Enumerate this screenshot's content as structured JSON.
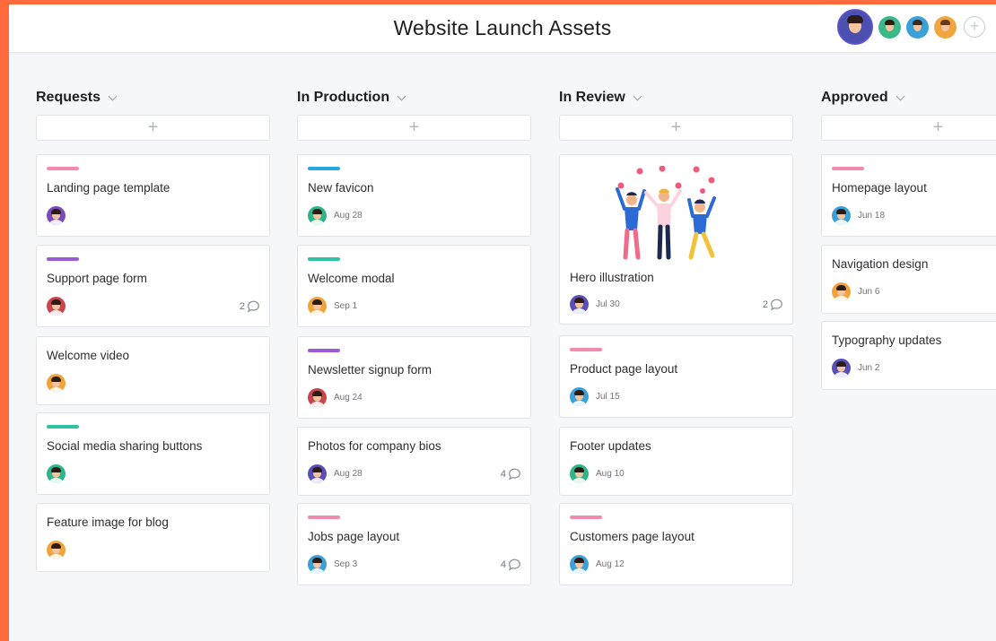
{
  "header": {
    "title": "Website Launch Assets",
    "members": [
      {
        "bg": "#4a4fb0"
      },
      {
        "bg": "#39b98a"
      },
      {
        "bg": "#3aa0d8"
      },
      {
        "bg": "#f0a640"
      }
    ],
    "add_label": "+"
  },
  "add_card_label": "+",
  "columns": [
    {
      "name": "Requests",
      "cards": [
        {
          "title": "Landing page template",
          "tag": "#f38aaf",
          "avatar": "#7a4ab8",
          "date": "",
          "comments": ""
        },
        {
          "title": "Support page form",
          "tag": "#9b5bd6",
          "avatar": "#c9454d",
          "date": "",
          "comments": "2"
        },
        {
          "title": "Welcome video",
          "tag": "",
          "avatar": "#f2a33a",
          "date": "",
          "comments": ""
        },
        {
          "title": "Social media sharing buttons",
          "tag": "#2ec4a2",
          "avatar": "#2eb58a",
          "date": "",
          "comments": ""
        },
        {
          "title": "Feature image for blog",
          "tag": "",
          "avatar": "#f2a33a",
          "date": "",
          "comments": ""
        }
      ]
    },
    {
      "name": "In Production",
      "cards": [
        {
          "title": "New favicon",
          "tag": "#29a8e0",
          "avatar": "#2eb58a",
          "date": "Aug 28",
          "comments": ""
        },
        {
          "title": "Welcome modal",
          "tag": "#2ec4a2",
          "avatar": "#f2a33a",
          "date": "Sep 1",
          "comments": ""
        },
        {
          "title": "Newsletter signup form",
          "tag": "#9b5bd6",
          "avatar": "#c9454d",
          "date": "Aug 24",
          "comments": ""
        },
        {
          "title": "Photos for company bios",
          "tag": "",
          "avatar": "#5a4fb8",
          "date": "Aug 28",
          "comments": "4"
        },
        {
          "title": "Jobs page layout",
          "tag": "#f38aaf",
          "avatar": "#3aa0d8",
          "date": "Sep 3",
          "comments": "4"
        }
      ]
    },
    {
      "name": "In Review",
      "cards": [
        {
          "title": "Hero illustration",
          "tag": "",
          "avatar": "#5a4fb8",
          "date": "Jul 30",
          "comments": "2",
          "image": true
        },
        {
          "title": "Product page layout",
          "tag": "#f38aaf",
          "avatar": "#3aa0d8",
          "date": "Jul 15",
          "comments": ""
        },
        {
          "title": "Footer updates",
          "tag": "",
          "avatar": "#2eb58a",
          "date": "Aug 10",
          "comments": ""
        },
        {
          "title": "Customers page layout",
          "tag": "#f38aaf",
          "avatar": "#3aa0d8",
          "date": "Aug 12",
          "comments": ""
        }
      ]
    },
    {
      "name": "Approved",
      "cards": [
        {
          "title": "Homepage layout",
          "tag": "#f38aaf",
          "avatar": "#3aa0d8",
          "date": "Jun 18",
          "comments": ""
        },
        {
          "title": "Navigation design",
          "tag": "",
          "avatar": "#f2a33a",
          "date": "Jun 6",
          "comments": ""
        },
        {
          "title": "Typography updates",
          "tag": "",
          "avatar": "#5a4fb8",
          "date": "Jun 2",
          "comments": ""
        }
      ]
    }
  ]
}
